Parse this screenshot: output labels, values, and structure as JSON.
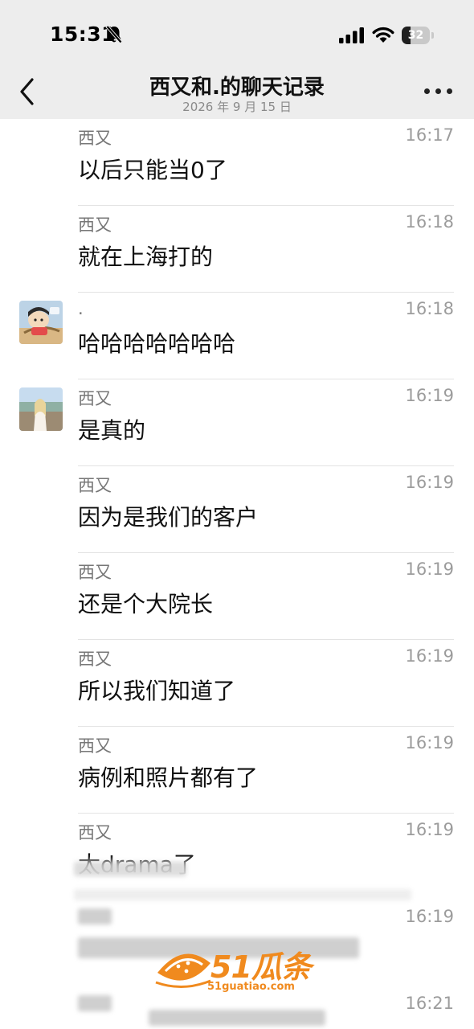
{
  "status_bar": {
    "time": "15:31",
    "battery": "32",
    "battery_level": 0.32
  },
  "nav": {
    "title": "西又和.的聊天记录",
    "subtitle": "2026 年 9 月 15 日"
  },
  "messages": [
    {
      "sender": "西又",
      "time": "16:17",
      "text": "以后只能当0了",
      "avatar": ""
    },
    {
      "sender": "西又",
      "time": "16:18",
      "text": "就在上海打的",
      "avatar": ""
    },
    {
      "sender": ".",
      "time": "16:18",
      "text": "哈哈哈哈哈哈哈",
      "avatar": "cartoon-avatar"
    },
    {
      "sender": "西又",
      "time": "16:19",
      "text": "是真的",
      "avatar": "photo-avatar"
    },
    {
      "sender": "西又",
      "time": "16:19",
      "text": "因为是我们的客户",
      "avatar": ""
    },
    {
      "sender": "西又",
      "time": "16:19",
      "text": "还是个大院长",
      "avatar": ""
    },
    {
      "sender": "西又",
      "time": "16:19",
      "text": "所以我们知道了",
      "avatar": ""
    },
    {
      "sender": "西又",
      "time": "16:19",
      "text": "病例和照片都有了",
      "avatar": ""
    },
    {
      "sender": "西又",
      "time": "16:19",
      "text": "太drama了",
      "avatar": ""
    },
    {
      "sender": "",
      "time": "16:19",
      "text": "",
      "avatar": ""
    },
    {
      "sender": "",
      "time": "16:21",
      "text": "",
      "avatar": ""
    }
  ],
  "watermark": {
    "name": "51瓜条",
    "url": "51guatiao.com"
  },
  "colors": {
    "header_bg": "#ededed",
    "watermark": "#f08a1e"
  }
}
